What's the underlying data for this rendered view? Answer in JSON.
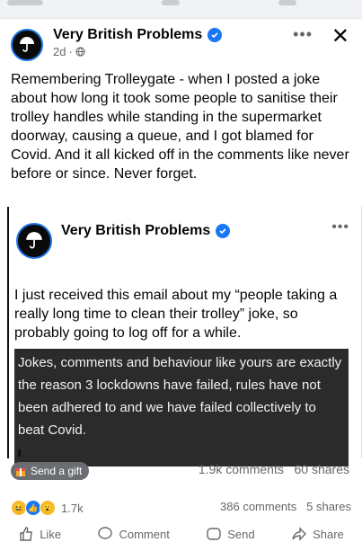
{
  "post": {
    "author": "Very British Problems",
    "time": "2d",
    "text": "Remembering Trolleygate - when I posted a joke about how long it took some people to sanitise their trolley handles while standing in the supermarket doorway, causing a queue, and I got blamed for Covid. And it all kicked off in the comments like never before or since. Never forget."
  },
  "embedded": {
    "author": "Very British Problems",
    "text": "I just received this email about my “people taking a really long time to clean their trolley” joke, so probably going to log off for a while.",
    "quote": "Jokes, comments and behaviour like yours are exactly the reason 3 lockdowns have failed, rules have not been adhered to and we have failed collectively to beat Covid.",
    "gift_label": "Send a gift",
    "comments": "1.9k comments",
    "shares": "60 shares"
  },
  "footer": {
    "reaction_count": "1.7k",
    "comments": "386 comments",
    "shares": "5 shares",
    "actions": [
      "Like",
      "Comment",
      "Send",
      "Share"
    ]
  },
  "icons": [
    "umbrella-icon",
    "verified-icon",
    "globe-icon",
    "more-icon",
    "close-icon",
    "gift-icon",
    "like-icon",
    "comment-icon",
    "send-icon",
    "share-icon"
  ],
  "colors": {
    "brand": "#1877f2",
    "quote_bg": "#2b2b2b",
    "meta": "#65676b"
  }
}
